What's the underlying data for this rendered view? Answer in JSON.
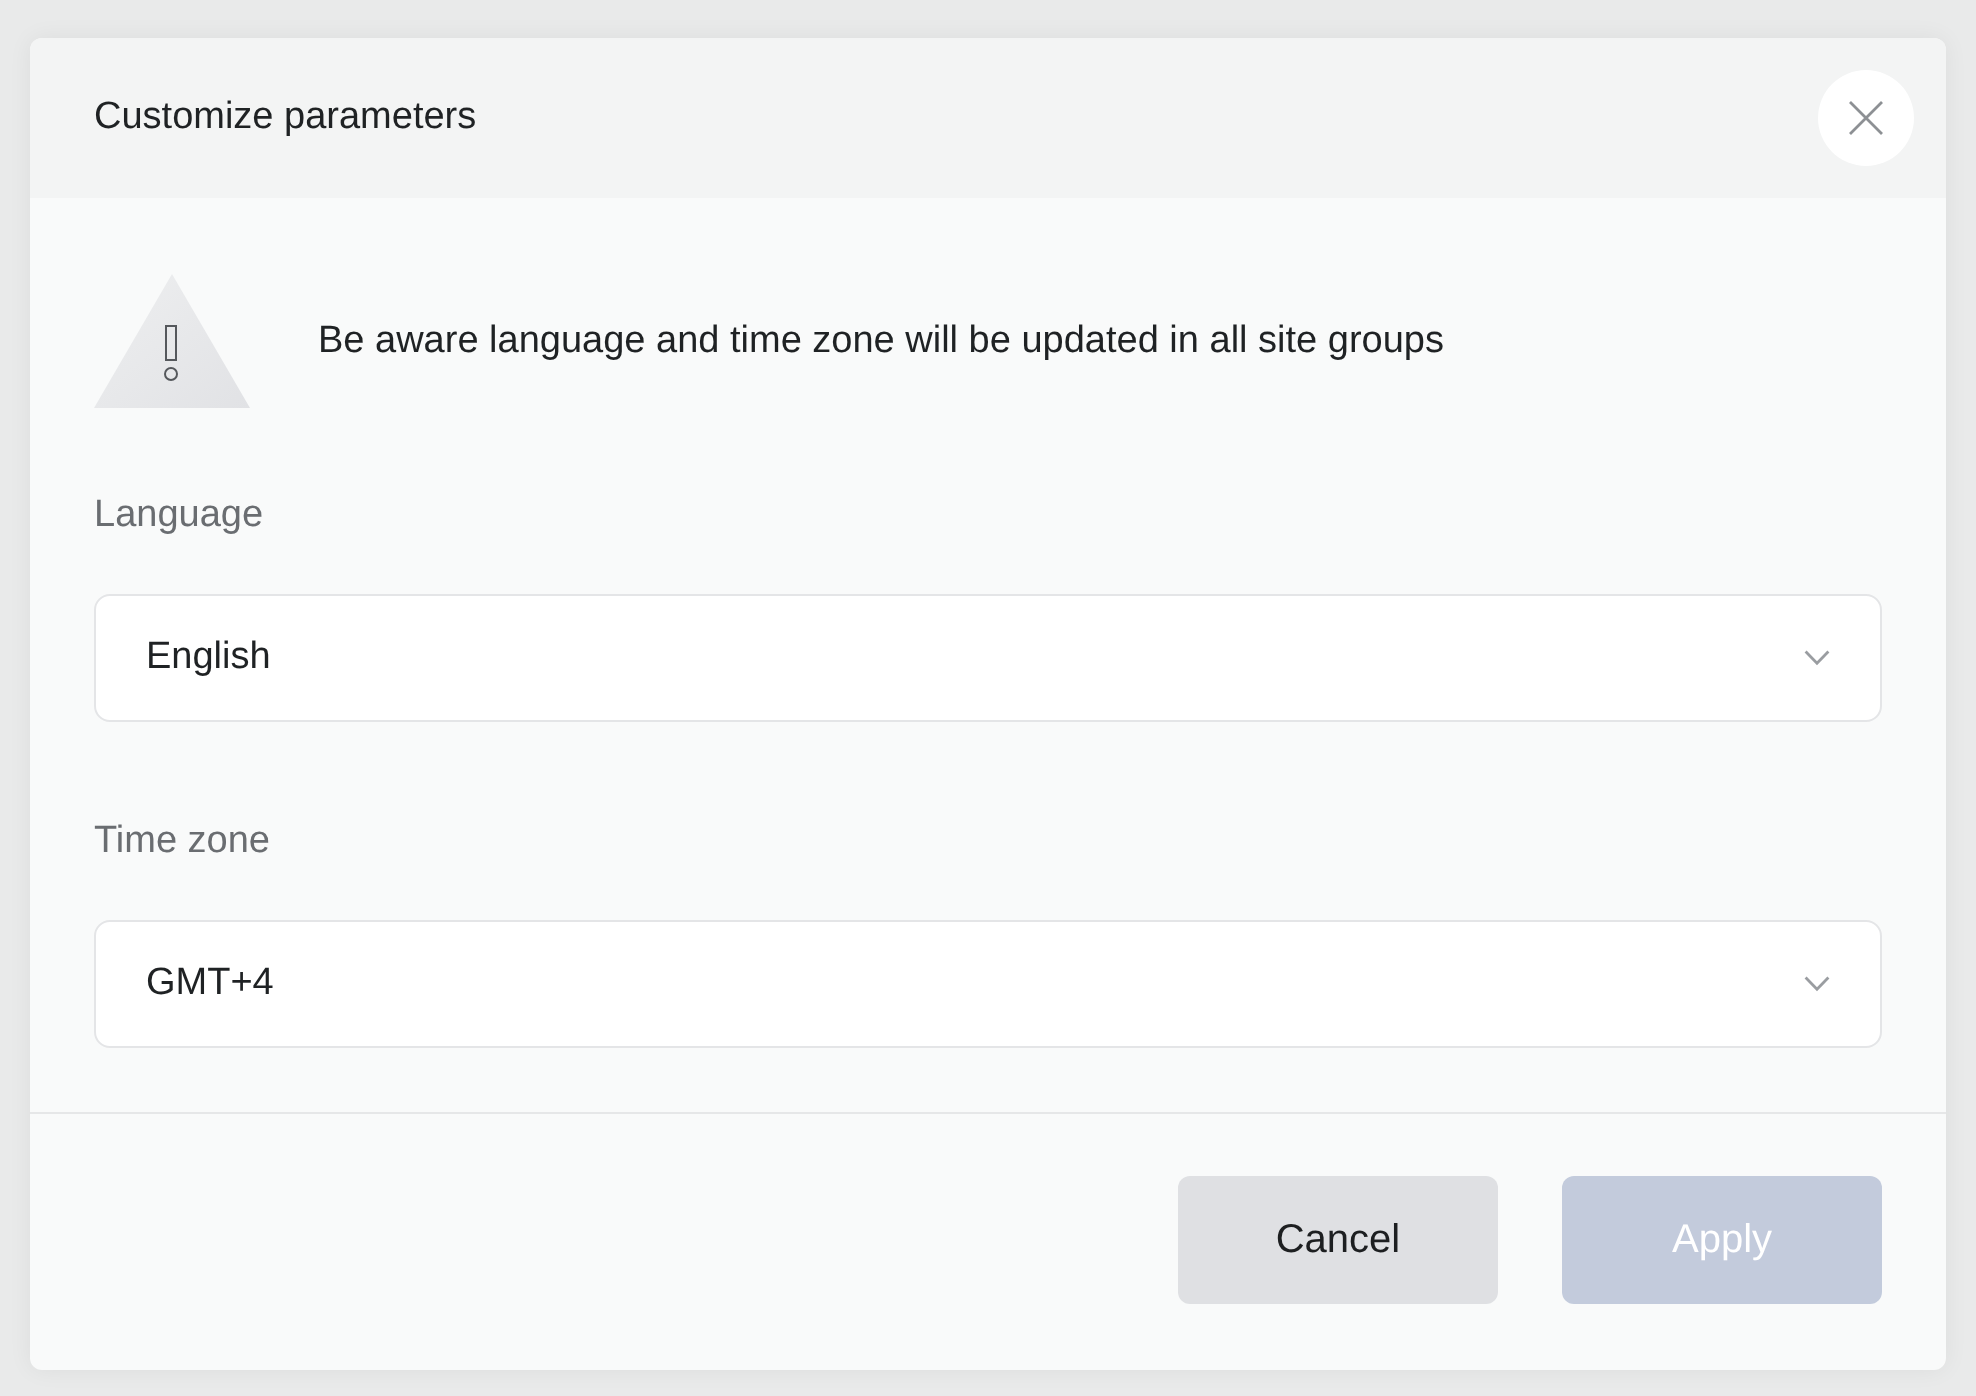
{
  "dialog": {
    "title": "Customize parameters"
  },
  "warning": {
    "message": "Be aware language and time zone will be updated in all site groups"
  },
  "fields": [
    {
      "label": "Language",
      "value": "English"
    },
    {
      "label": "Time zone",
      "value": "GMT+4"
    }
  ],
  "buttons": [
    {
      "label": "Cancel",
      "kind": "secondary",
      "disabled": false
    },
    {
      "label": "Apply",
      "kind": "primary",
      "disabled": true
    }
  ]
}
